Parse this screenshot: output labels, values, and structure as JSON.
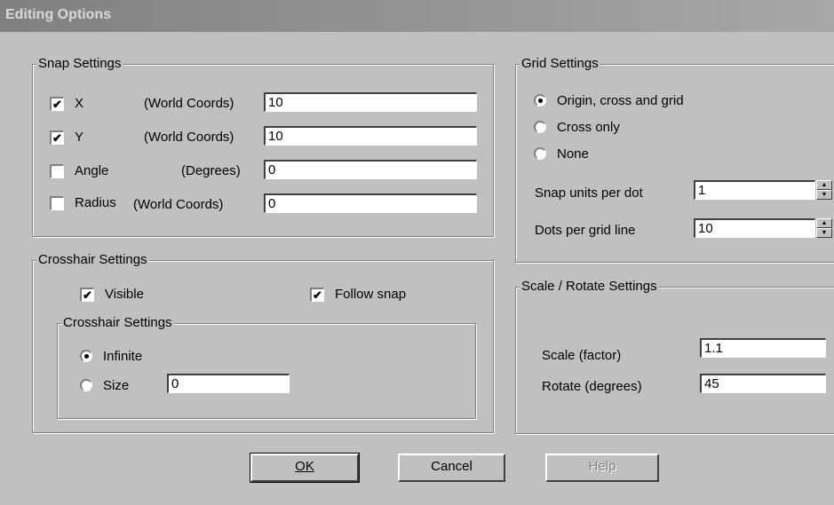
{
  "window": {
    "title": "Editing Options"
  },
  "snap": {
    "legend": "Snap Settings",
    "rows": [
      {
        "label": "X",
        "unit": "(World Coords)",
        "checked": true,
        "value": "10"
      },
      {
        "label": "Y",
        "unit": "(World Coords)",
        "checked": true,
        "value": "10"
      },
      {
        "label": "Angle",
        "unit": "(Degrees)",
        "checked": false,
        "value": "0"
      },
      {
        "label": "Radius",
        "unit": "(World Coords)",
        "checked": false,
        "value": "0"
      }
    ]
  },
  "crosshair": {
    "legend": "Crosshair Settings",
    "visible_label": "Visible",
    "visible_checked": true,
    "follow_snap_label": "Follow snap",
    "follow_snap_checked": true,
    "inner_legend": "Crosshair Settings",
    "infinite_label": "Infinite",
    "size_label": "Size",
    "size_value": "0",
    "selected": "Infinite"
  },
  "grid": {
    "legend": "Grid Settings",
    "options": [
      "Origin, cross and grid",
      "Cross only",
      "None"
    ],
    "selected": "Origin, cross and grid",
    "snap_units_label": "Snap units per dot",
    "snap_units_value": "1",
    "dots_label": "Dots per grid line",
    "dots_value": "10"
  },
  "scale_rotate": {
    "legend": "Scale / Rotate Settings",
    "scale_label": "Scale (factor)",
    "scale_value": "1.1",
    "rotate_label": "Rotate (degrees)",
    "rotate_value": "45"
  },
  "buttons": {
    "ok": "OK",
    "cancel": "Cancel",
    "help": "Help"
  }
}
